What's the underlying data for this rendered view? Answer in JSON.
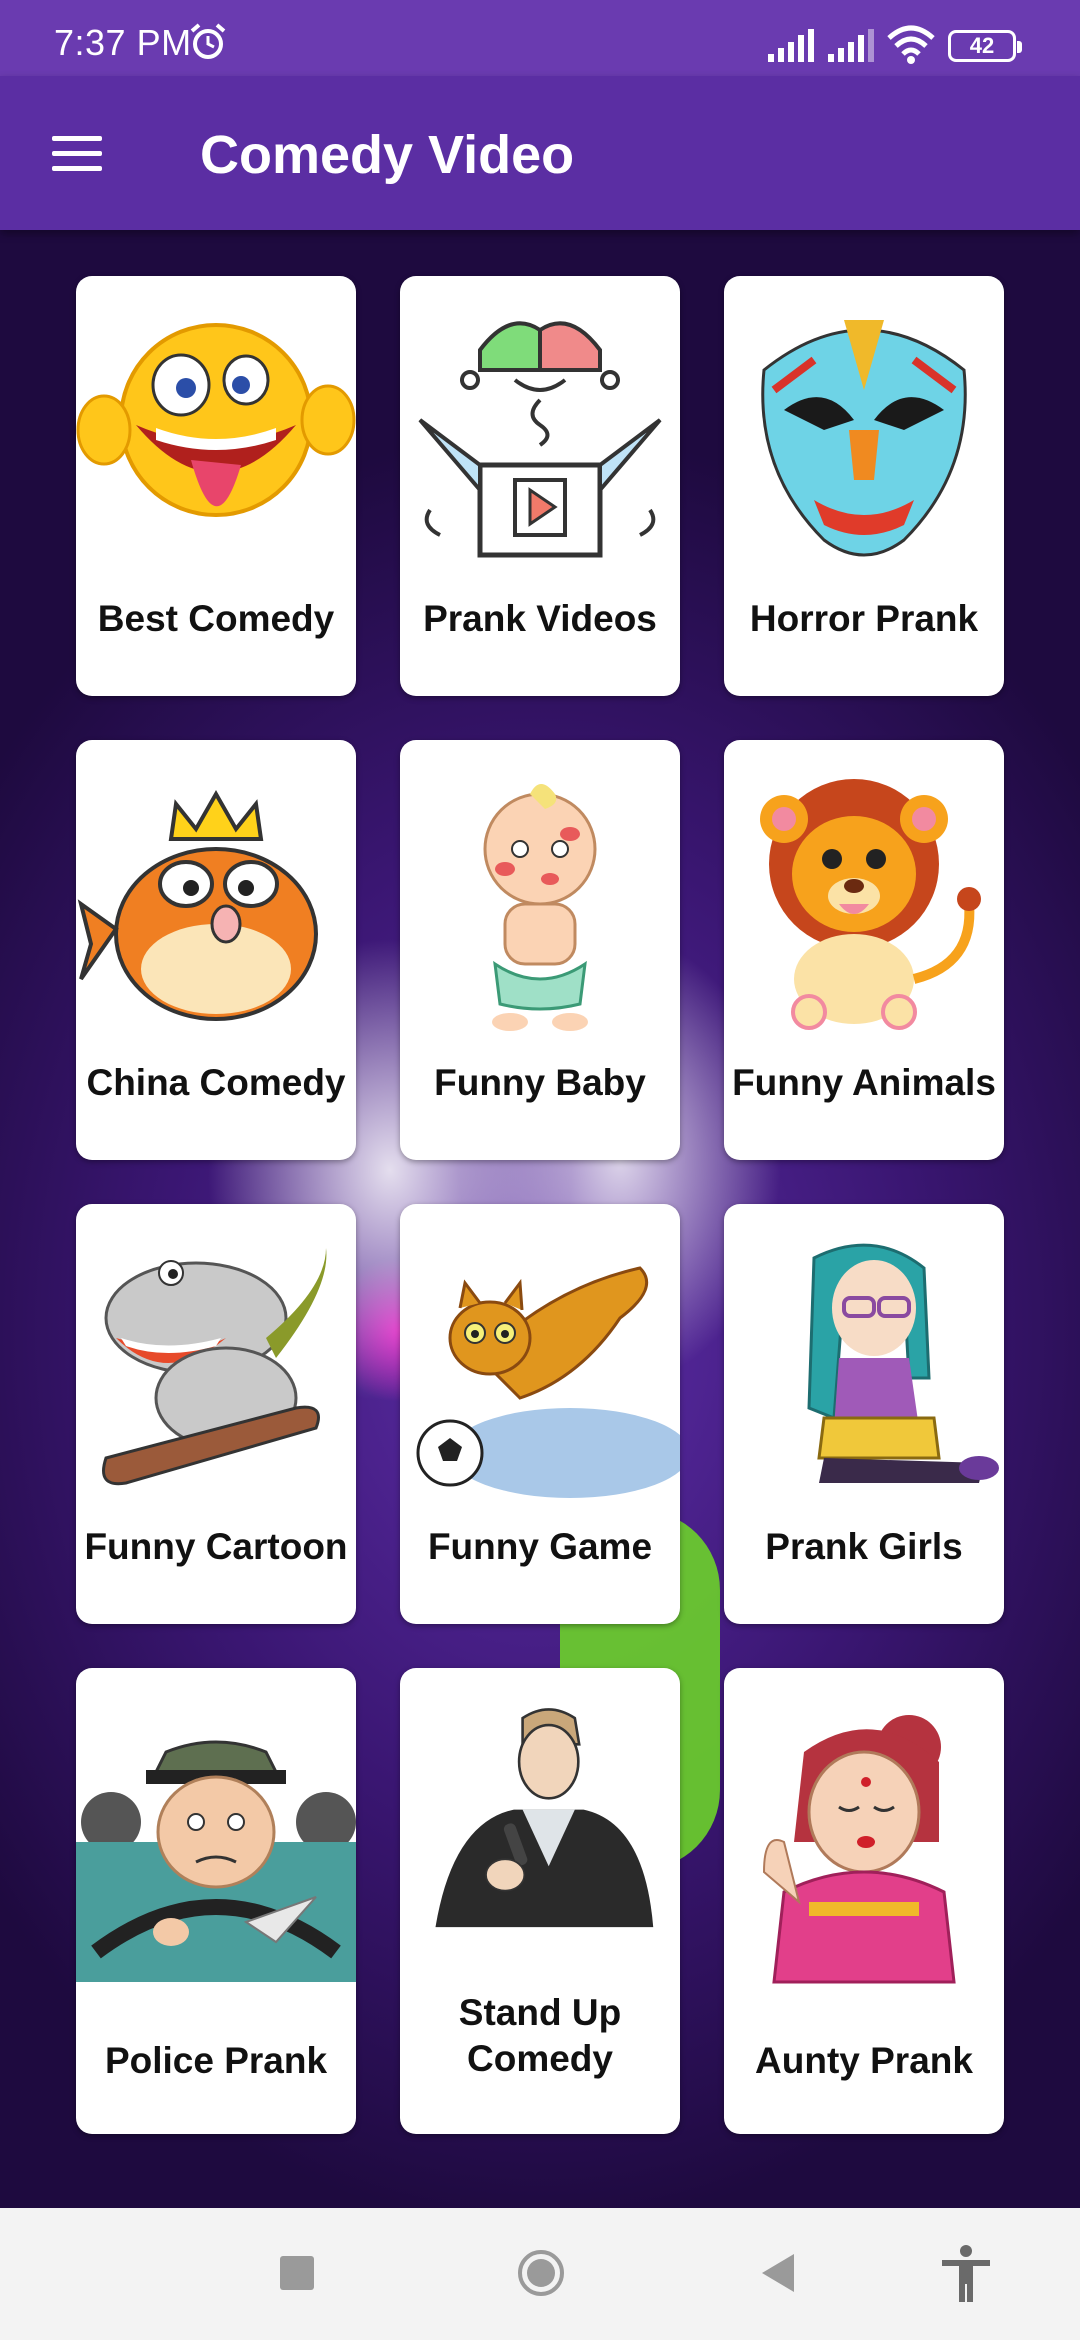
{
  "status_bar": {
    "time": "7:37 PM",
    "battery": "42",
    "icons": [
      "alarm-icon",
      "signal-icon",
      "signal-icon",
      "wifi-icon",
      "battery-icon"
    ]
  },
  "app_bar": {
    "title": "Comedy Video",
    "menu_icon": "hamburger-menu-icon",
    "color": "#5b2ea3"
  },
  "categories": [
    {
      "label": "Best Comedy",
      "art": "laughing-emoji"
    },
    {
      "label": "Prank Videos",
      "art": "jester-box"
    },
    {
      "label": "Horror Prank",
      "art": "opera-mask"
    },
    {
      "label": "China Comedy",
      "art": "crowned-fish"
    },
    {
      "label": "Funny Baby",
      "art": "baby"
    },
    {
      "label": "Funny Animals",
      "art": "lion"
    },
    {
      "label": "Funny Cartoon",
      "art": "hippo-sled"
    },
    {
      "label": "Funny Game",
      "art": "cat-soccer"
    },
    {
      "label": "Prank Girls",
      "art": "girl-sitting"
    },
    {
      "label": "Police Prank",
      "art": "police-driver"
    },
    {
      "label": "Stand Up Comedy",
      "art": "comedian-mic"
    },
    {
      "label": "Aunty Prank",
      "art": "aunty"
    }
  ],
  "nav_bar": {
    "icons": [
      "recents-icon",
      "home-icon",
      "back-icon",
      "accessibility-icon"
    ]
  }
}
